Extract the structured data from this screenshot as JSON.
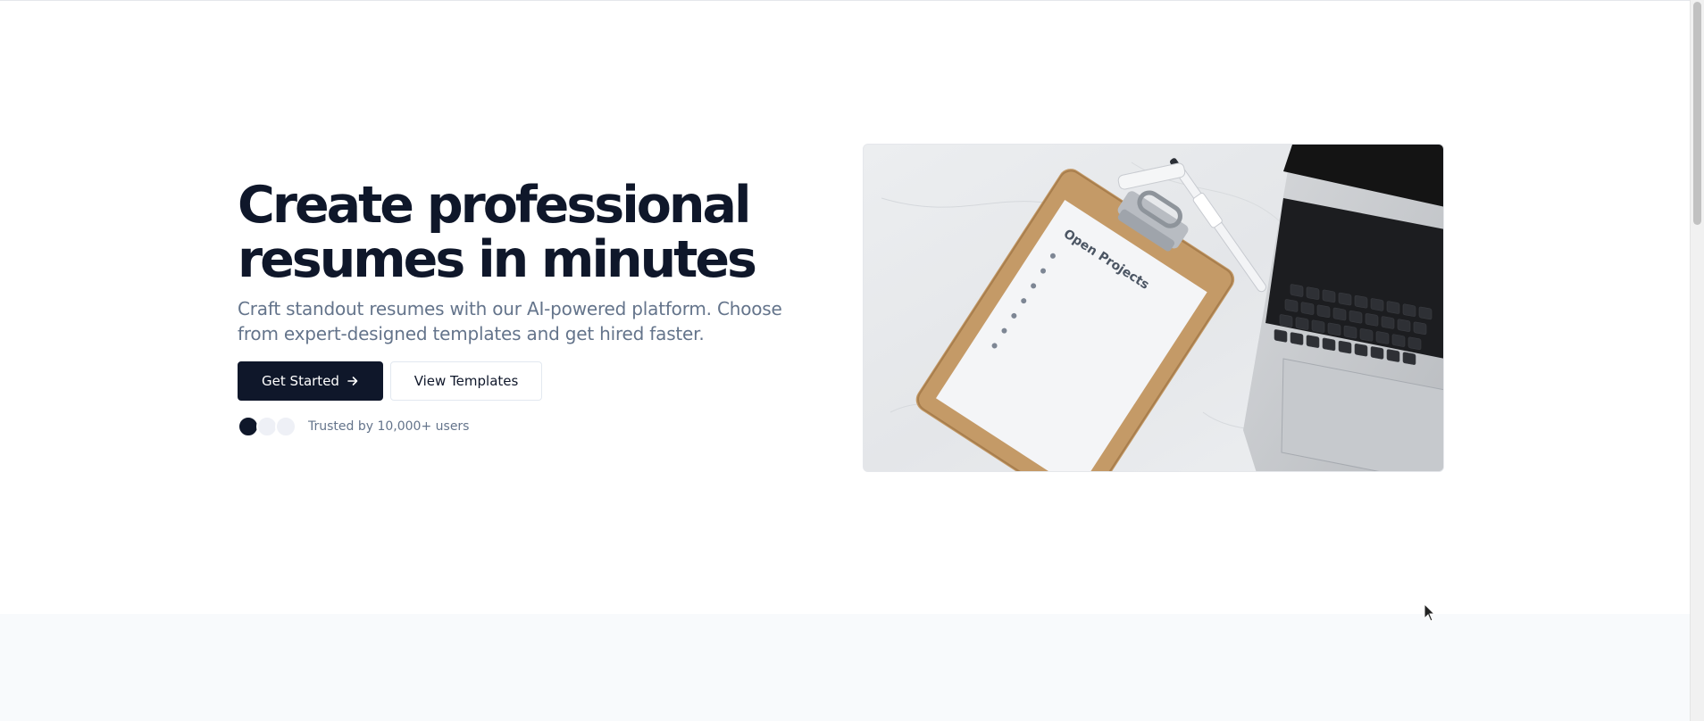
{
  "hero": {
    "headline_line1": "Create professional",
    "headline_line2": "resumes in minutes",
    "subhead": "Craft standout resumes with our AI-powered platform. Choose from expert-designed templates and get hired faster.",
    "primary_cta": "Get Started",
    "secondary_cta": "View Templates",
    "trust_text": "Trusted by 10,000+ users",
    "image": {
      "clipboard_title": "Open Projects",
      "icon": "hero-photo-clipboard-laptop"
    }
  },
  "colors": {
    "primary": "#0f172a",
    "muted_text": "#64748b",
    "section_alt_bg": "#f8fafc",
    "avatar_light": "#eef0f6"
  },
  "icons": {
    "primary_cta_icon": "arrow-right-icon"
  }
}
